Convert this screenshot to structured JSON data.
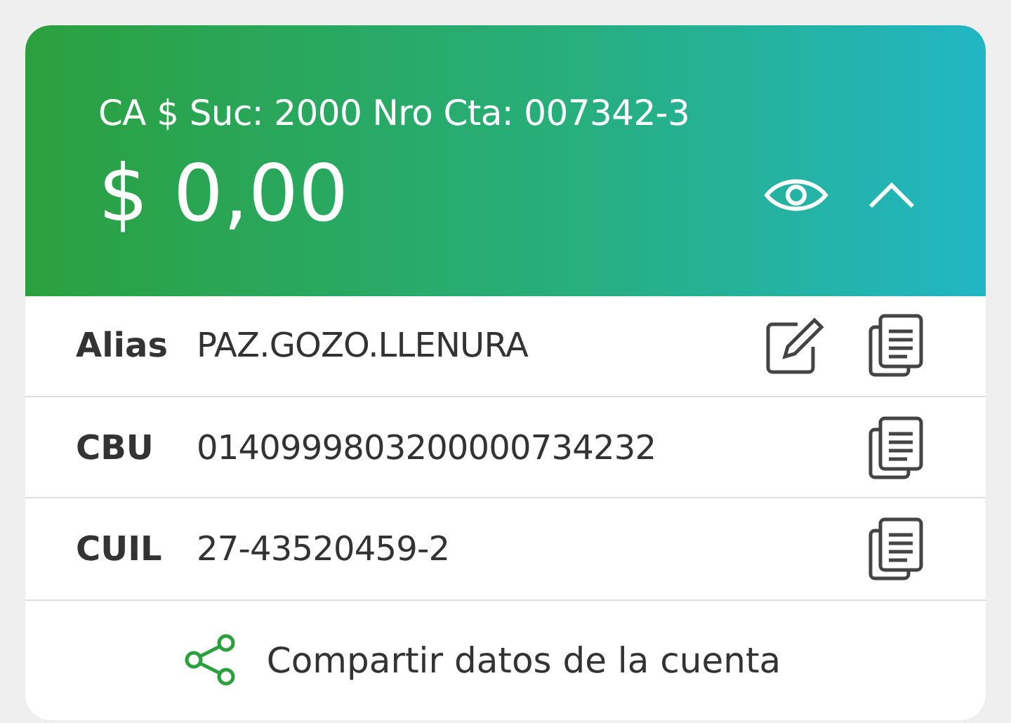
{
  "account": {
    "title": "CA $ Suc: 2000 Nro Cta: 007342-3",
    "balance": "$ 0,00",
    "expanded": true
  },
  "details": [
    {
      "label": "Alias",
      "value": "PAZ.GOZO.LLENURA",
      "editable": true
    },
    {
      "label": "CBU",
      "value": "0140999803200000734232",
      "editable": false
    },
    {
      "label": "CUIL",
      "value": "27-43520459-2",
      "editable": false
    }
  ],
  "share": {
    "label": "Compartir datos de la cuenta"
  }
}
